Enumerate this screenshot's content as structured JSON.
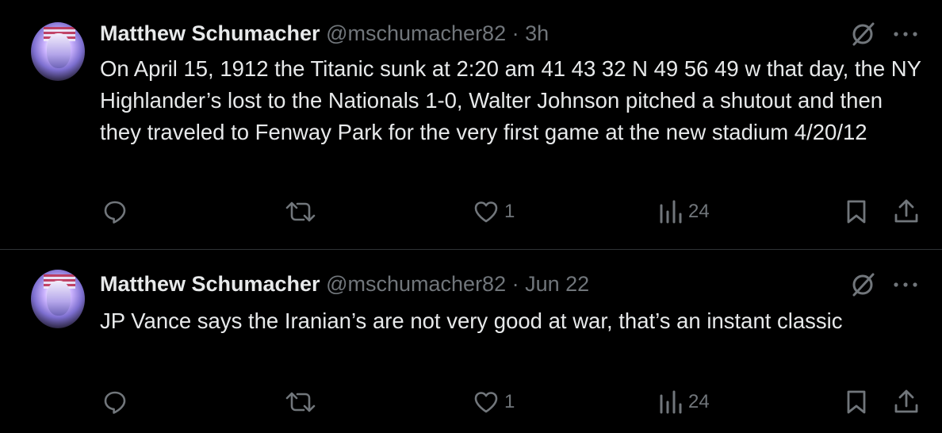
{
  "tweets": [
    {
      "author": "Matthew Schumacher",
      "handle": "@mschumacher82",
      "separator": "·",
      "time": "3h",
      "text": "On April 15, 1912 the Titanic sunk at 2:20 am 41 43 32 N 49 56 49 w that day, the NY Highlander’s lost to the Nationals 1-0, Walter Johnson pitched a shutout and then they traveled to Fenway Park for the very first game at the new stadium 4/20/12",
      "likes": "1",
      "views": "24"
    },
    {
      "author": "Matthew Schumacher",
      "handle": "@mschumacher82",
      "separator": "·",
      "time": "Jun 22",
      "text": "JP Vance says the Iranian’s are not very good at war, that’s an instant classic",
      "likes": "1",
      "views": "24"
    }
  ],
  "icons": {
    "grok": "grok-icon",
    "more": "more-options-icon",
    "reply": "reply-icon",
    "retweet": "retweet-icon",
    "like": "like-icon",
    "views": "views-icon",
    "bookmark": "bookmark-icon",
    "share": "share-icon"
  },
  "colors": {
    "background": "#000000",
    "text": "#e7e9ea",
    "muted": "#71767b",
    "divider": "#2f3336"
  }
}
